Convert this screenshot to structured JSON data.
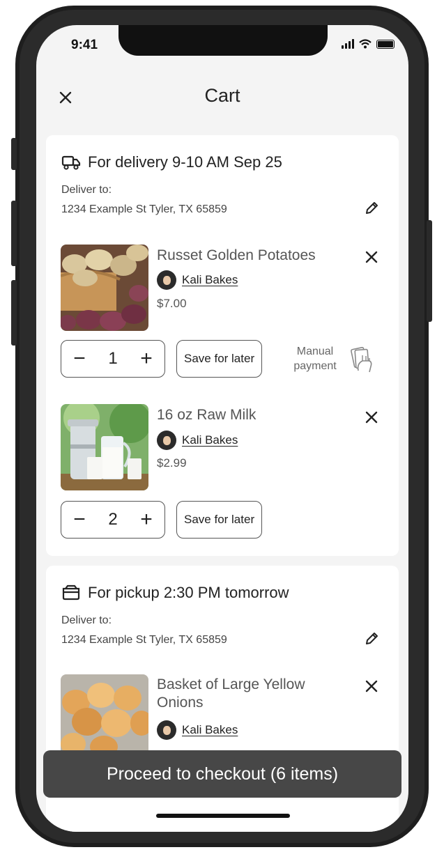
{
  "status_bar": {
    "time": "9:41"
  },
  "header": {
    "title": "Cart",
    "close_icon": "close-icon"
  },
  "sections": [
    {
      "title": "For delivery 9-10 AM Sep 25",
      "icon": "truck-icon",
      "deliver_label": "Deliver to:",
      "address": "1234 Example St Tyler, TX 65859",
      "items": [
        {
          "name": "Russet Golden Potatoes",
          "seller": "Kali Bakes",
          "price": "$7.00",
          "quantity": "1",
          "save_label": "Save for later",
          "manual_line1": "Manual",
          "manual_line2": "payment"
        },
        {
          "name": "16 oz Raw Milk",
          "seller": "Kali Bakes",
          "price": "$2.99",
          "quantity": "2",
          "save_label": "Save for later"
        }
      ]
    },
    {
      "title": "For pickup 2:30 PM tomorrow",
      "icon": "pickup-box-icon",
      "deliver_label": "Deliver to:",
      "address": "1234 Example St Tyler, TX 65859",
      "items": [
        {
          "name_line1": "Basket of Large Yellow",
          "name_line2": "Onions",
          "seller": "Kali Bakes"
        }
      ]
    }
  ],
  "stepper": {
    "minus": "−",
    "plus": "+"
  },
  "checkout_button": "Proceed to checkout (6 items)",
  "colors": {
    "checkout_bg": "#474747",
    "card_bg": "#ffffff",
    "screen_bg": "#f4f4f4"
  }
}
